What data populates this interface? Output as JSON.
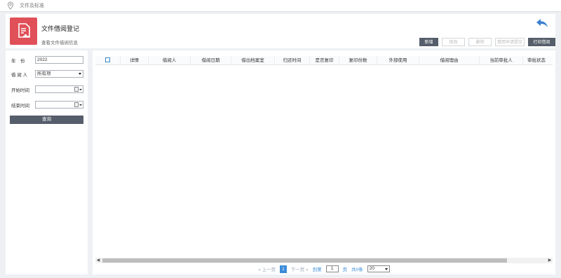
{
  "topbar": {
    "breadcrumb": "文件及标准",
    "icon": "location-pin-icon"
  },
  "header": {
    "title": "文件借阅登记",
    "subtitle": "查看文件借阅信息",
    "logo_icon": "document-stamp-icon",
    "logo_color": "#e05058",
    "back_icon": "back-arrow-icon"
  },
  "toolbar": {
    "add": "新增",
    "edit": "修改",
    "delete": "删除",
    "submit": "借用申请提交",
    "print": "打印借阅"
  },
  "filters": {
    "year_label": "年　份",
    "year_value": "2022",
    "borrower_label": "借 阅 人",
    "borrower_value": "所有项",
    "start_label": "开始时间",
    "start_value": "",
    "end_label": "结束时间",
    "end_value": "",
    "query_button": "查询"
  },
  "table": {
    "columns": [
      "详情",
      "借阅人",
      "借阅日期",
      "借出档案室",
      "归还时间",
      "是否复印",
      "复印份数",
      "外部使用",
      "借阅理由",
      "当前审批人",
      "审批状态"
    ],
    "rows": []
  },
  "pager": {
    "prev": "« 上一页",
    "current_page": "1",
    "next": "下一页 »",
    "goto_label": "到第",
    "goto_value": "1",
    "page_unit": "页",
    "total": "共0条",
    "page_size": "20"
  },
  "colors": {
    "primary_button": "#555e6a",
    "accent": "#3c8bd9"
  }
}
